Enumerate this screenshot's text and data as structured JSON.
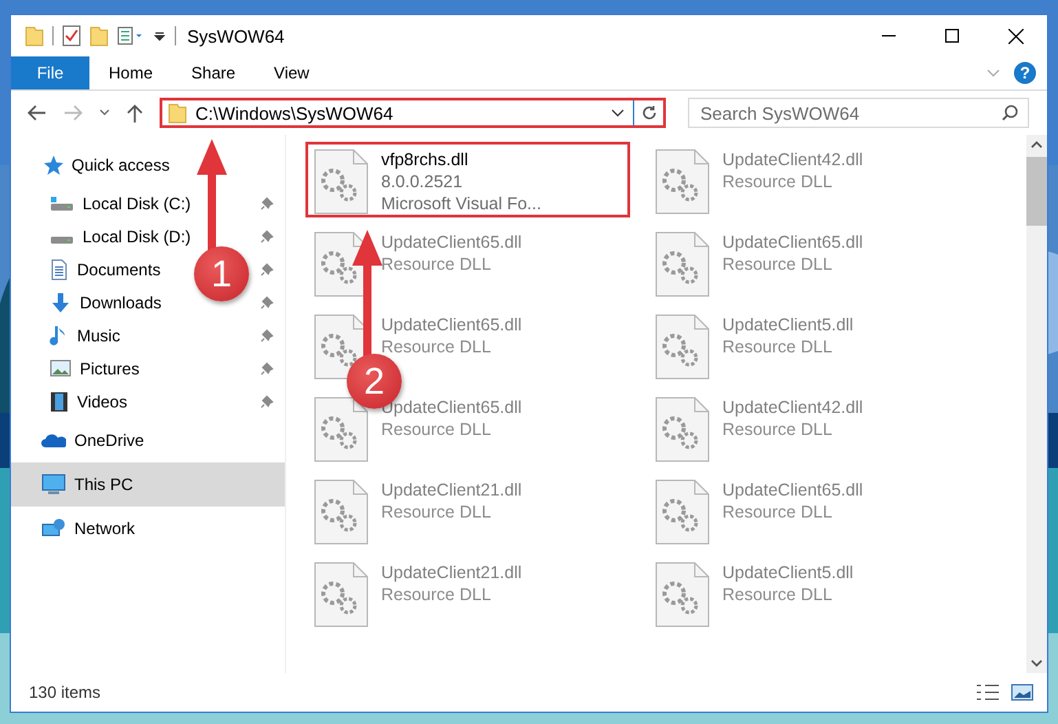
{
  "window": {
    "title": "SysWOW64"
  },
  "ribbon": {
    "file_tab": "File",
    "tabs": [
      "Home",
      "Share",
      "View"
    ],
    "help": "?"
  },
  "address_bar": {
    "path": "C:\\Windows\\SysWOW64",
    "annotated": true
  },
  "search": {
    "placeholder": "Search SysWOW64"
  },
  "navigation": [
    {
      "label": "Quick access",
      "selected": false,
      "children": [
        {
          "label": "Local Disk (C:)",
          "pinned": true
        },
        {
          "label": "Local Disk (D:)",
          "pinned": true
        },
        {
          "label": "Documents",
          "pinned": true
        },
        {
          "label": "Downloads",
          "pinned": true
        },
        {
          "label": "Music",
          "pinned": true
        },
        {
          "label": "Pictures",
          "pinned": true
        },
        {
          "label": "Videos",
          "pinned": true
        }
      ]
    },
    {
      "label": "OneDrive",
      "selected": false
    },
    {
      "label": "This PC",
      "selected": true
    },
    {
      "label": "Network",
      "selected": false
    }
  ],
  "files": [
    {
      "name": "vfp8rchs.dll",
      "lines": [
        "8.0.0.2521",
        "Microsoft Visual Fo..."
      ],
      "blurred": false,
      "annotated": true
    },
    {
      "name": "UpdateClient42.dll",
      "lines": [
        "Resource DLL"
      ],
      "blurred": true,
      "annotated": false
    },
    {
      "name": "UpdateClient65.dll",
      "lines": [
        "Resource DLL"
      ],
      "blurred": true,
      "annotated": false
    },
    {
      "name": "UpdateClient65.dll",
      "lines": [
        "Resource DLL"
      ],
      "blurred": true,
      "annotated": false
    },
    {
      "name": "UpdateClient65.dll",
      "lines": [
        "Resource DLL"
      ],
      "blurred": true,
      "annotated": false
    },
    {
      "name": "UpdateClient5.dll",
      "lines": [
        "Resource DLL"
      ],
      "blurred": true,
      "annotated": false
    },
    {
      "name": "UpdateClient65.dll",
      "lines": [
        "Resource DLL"
      ],
      "blurred": true,
      "annotated": false
    },
    {
      "name": "UpdateClient42.dll",
      "lines": [
        "Resource DLL"
      ],
      "blurred": true,
      "annotated": false
    },
    {
      "name": "UpdateClient21.dll",
      "lines": [
        "Resource DLL"
      ],
      "blurred": true,
      "annotated": false
    },
    {
      "name": "UpdateClient65.dll",
      "lines": [
        "Resource DLL"
      ],
      "blurred": true,
      "annotated": false
    },
    {
      "name": "UpdateClient21.dll",
      "lines": [
        "Resource DLL"
      ],
      "blurred": true,
      "annotated": false
    },
    {
      "name": "UpdateClient5.dll",
      "lines": [
        "Resource DLL"
      ],
      "blurred": true,
      "annotated": false
    }
  ],
  "callouts": [
    {
      "number": "1"
    },
    {
      "number": "2"
    }
  ],
  "status_bar": {
    "count": "130 items"
  }
}
